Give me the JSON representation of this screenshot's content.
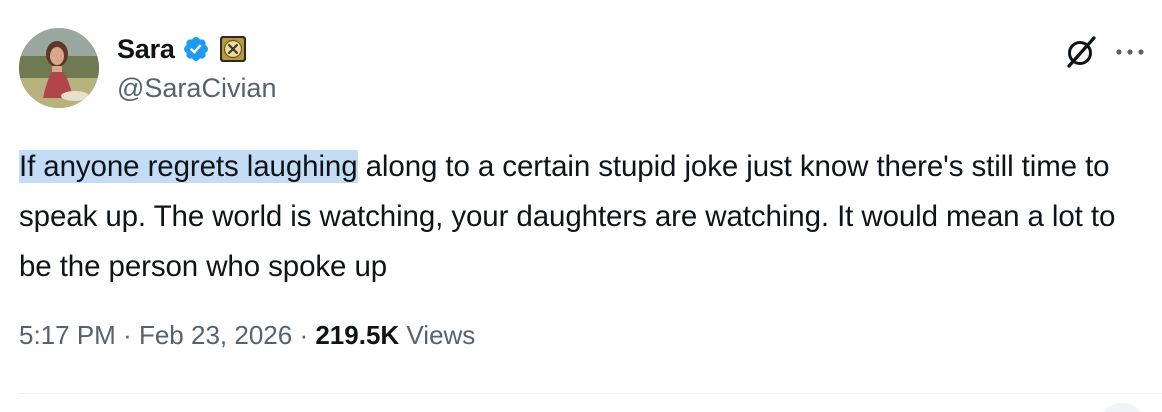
{
  "author": {
    "display_name": "Sara",
    "handle": "@SaraCivian",
    "verified_color": "#1d9bf0"
  },
  "tweet": {
    "highlighted_text": "If anyone regrets laughing",
    "remaining_text": " along to a certain stupid joke just know there's still time to speak up. The world is watching, your daughters are watching. It would mean a lot to be the person who spoke up"
  },
  "meta": {
    "time": "5:17 PM",
    "separator": "·",
    "date": "Feb 23, 2026",
    "views_count": "219.5K",
    "views_label": "Views"
  },
  "icons": {
    "verified": "verified-badge-icon",
    "affiliate": "affiliate-badge-icon",
    "grok": "grok-icon",
    "more": "more-options-icon"
  },
  "colors": {
    "text_primary": "#0f1419",
    "text_secondary": "#536471",
    "highlight": "#c5dcf6",
    "accent": "#1d9bf0"
  }
}
